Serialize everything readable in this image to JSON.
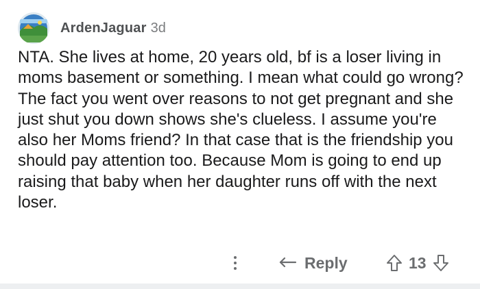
{
  "comment": {
    "username": "ArdenJaguar",
    "timestamp": "3d",
    "body": "NTA.  She lives at home, 20 years old, bf is a loser living in moms basement or something.  I mean what could go wrong?  The fact you went over reasons to not get pregnant and she just shut you down shows she's clueless.  I assume you're also her Moms friend?  In that case that is the friendship you should pay attention too.  Because Mom is going to end up raising that baby when her daughter runs off with the next loser.",
    "actions": {
      "reply_label": "Reply",
      "score": "13"
    }
  },
  "icons": {
    "avatar": "avatar-landscape-icon",
    "more": "more-vertical-icon",
    "reply": "reply-arrow-icon",
    "upvote": "upvote-arrow-icon",
    "downvote": "downvote-arrow-icon"
  },
  "colors": {
    "text": "#1a1a1b",
    "muted": "#6b6d6f",
    "divider": "#edeff1"
  }
}
